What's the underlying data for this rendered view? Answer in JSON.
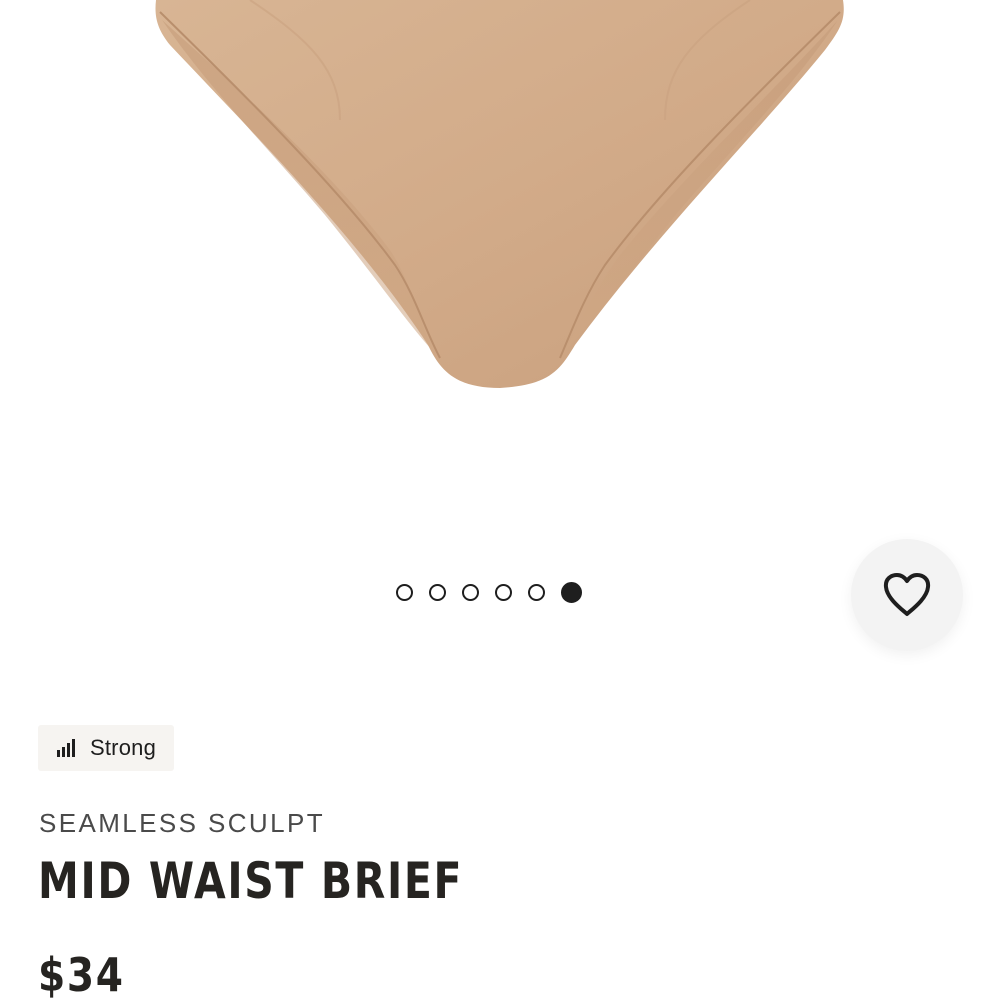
{
  "colors": {
    "product": "#d3ad8c",
    "text_dark": "#262421",
    "badge_bg": "#f6f4f1"
  },
  "gallery": {
    "image_count": 6,
    "active_index": 5
  },
  "wishlist": {
    "icon": "heart-icon"
  },
  "badge": {
    "icon": "signal-bars-icon",
    "label": "Strong"
  },
  "product": {
    "collection": "SEAMLESS SCULPT",
    "name": "MID WAIST BRIEF",
    "price": "$34"
  }
}
